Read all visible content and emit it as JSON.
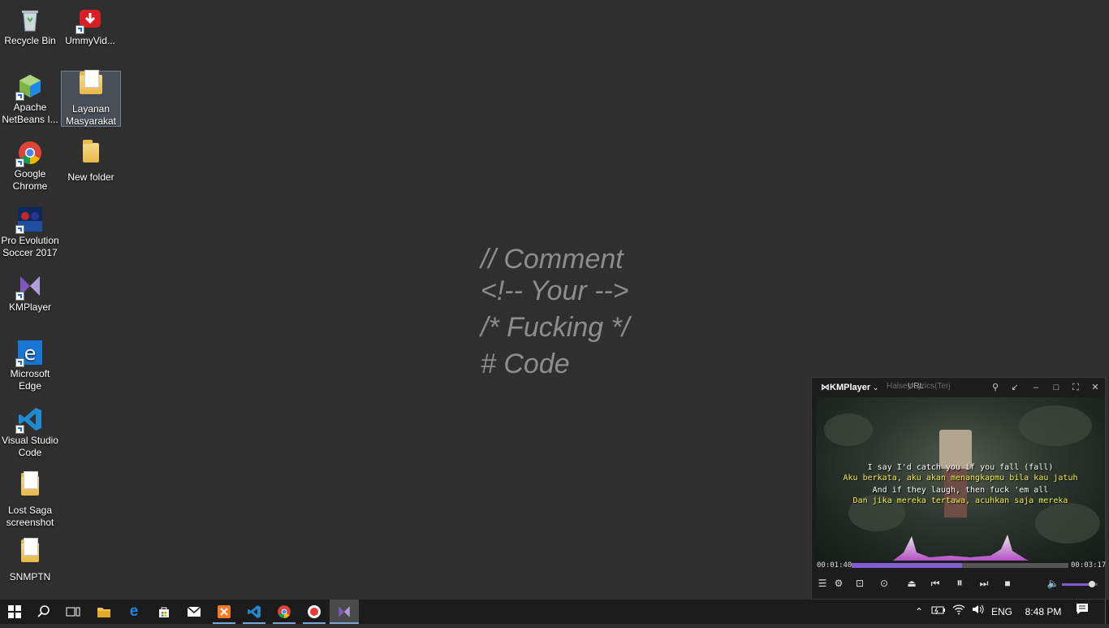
{
  "desktop": {
    "icons": [
      {
        "label": "Recycle Bin"
      },
      {
        "label": "UmmyVid..."
      },
      {
        "label": "Apache NetBeans I..."
      },
      {
        "label": "Layanan Masyarakat"
      },
      {
        "label": "Google Chrome"
      },
      {
        "label": "New folder"
      },
      {
        "label": "Pro Evolution Soccer 2017"
      },
      {
        "label": "KMPlayer"
      },
      {
        "label": "Microsoft Edge"
      },
      {
        "label": "Visual Studio Code"
      },
      {
        "label": "Lost Saga screenshot"
      },
      {
        "label": "SNMPTN"
      }
    ],
    "selected_icon": "Layanan Masyarakat"
  },
  "wallpaper": {
    "lines": [
      "// Comment",
      "<!-- Your -->",
      "/* Fucking */",
      "# Code"
    ],
    "text_color": "#8d8d8d",
    "background": "#2f2f2f"
  },
  "kmplayer": {
    "logo": "KMPlayer",
    "file_title": "Halsey Lyrics(Terj",
    "url_label": "URL",
    "subtitles": [
      {
        "text": "I say I'd catch you if you fall (fall)",
        "color": "white"
      },
      {
        "text": "Aku berkata, aku akan menangkapmu bila kau jatuh",
        "color": "yellow"
      },
      {
        "text": "And if they laugh, then fuck 'em all",
        "color": "white"
      },
      {
        "text": "Dan jika mereka tertawa, acuhkan saja mereka",
        "color": "yellow"
      }
    ],
    "current_time": "00:01:40",
    "total_time": "00:03:17",
    "progress": 0.51,
    "volume": 0.85,
    "accent": "#7d5fd0"
  },
  "taskbar": {
    "language": "ENG",
    "clock": "8:48 PM",
    "apps": [
      "windows-start",
      "search",
      "task-view",
      "file-explorer",
      "microsoft-edge",
      "microsoft-store",
      "mail",
      "xampp",
      "visual-studio-code",
      "google-chrome",
      "screen-recorder",
      "kmplayer"
    ]
  }
}
